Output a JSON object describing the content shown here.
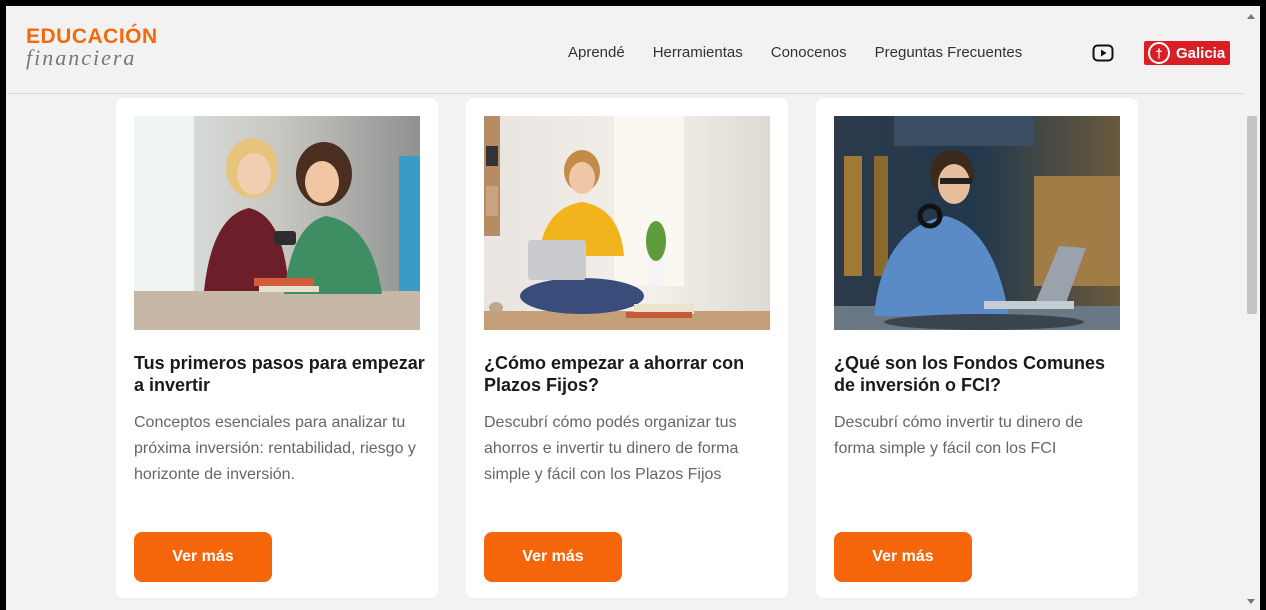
{
  "brand": {
    "logo_top": "EDUCACIÓN",
    "logo_bottom": "financiera",
    "accent": "#f26a10",
    "partner_label": "Galicia",
    "partner_color": "#d91f26"
  },
  "nav": {
    "items": [
      {
        "label": "Aprendé"
      },
      {
        "label": "Herramientas"
      },
      {
        "label": "Conocenos"
      },
      {
        "label": "Preguntas Frecuentes"
      }
    ],
    "video_icon": "youtube-icon"
  },
  "cards": [
    {
      "title": "Tus primeros pasos para empezar a invertir",
      "description": "Conceptos esenciales para analizar tu próxima inversión: rentabilidad, riesgo y horizonte de inversión.",
      "button": "Ver más",
      "image": "two-women-looking-at-phone"
    },
    {
      "title": "¿Cómo empezar a ahorrar con Plazos Fijos?",
      "description": "Descubrí cómo podés organizar tus ahorros e invertir tu dinero de forma simple y fácil con los Plazos Fijos",
      "button": "Ver más",
      "image": "woman-with-laptop-on-table"
    },
    {
      "title": "¿Qué son los Fondos Comunes de inversión o FCI?",
      "description": "Descubrí cómo invertir tu dinero de forma simple y fácil con los FCI",
      "button": "Ver más",
      "image": "man-with-headphones-at-laptop"
    }
  ]
}
